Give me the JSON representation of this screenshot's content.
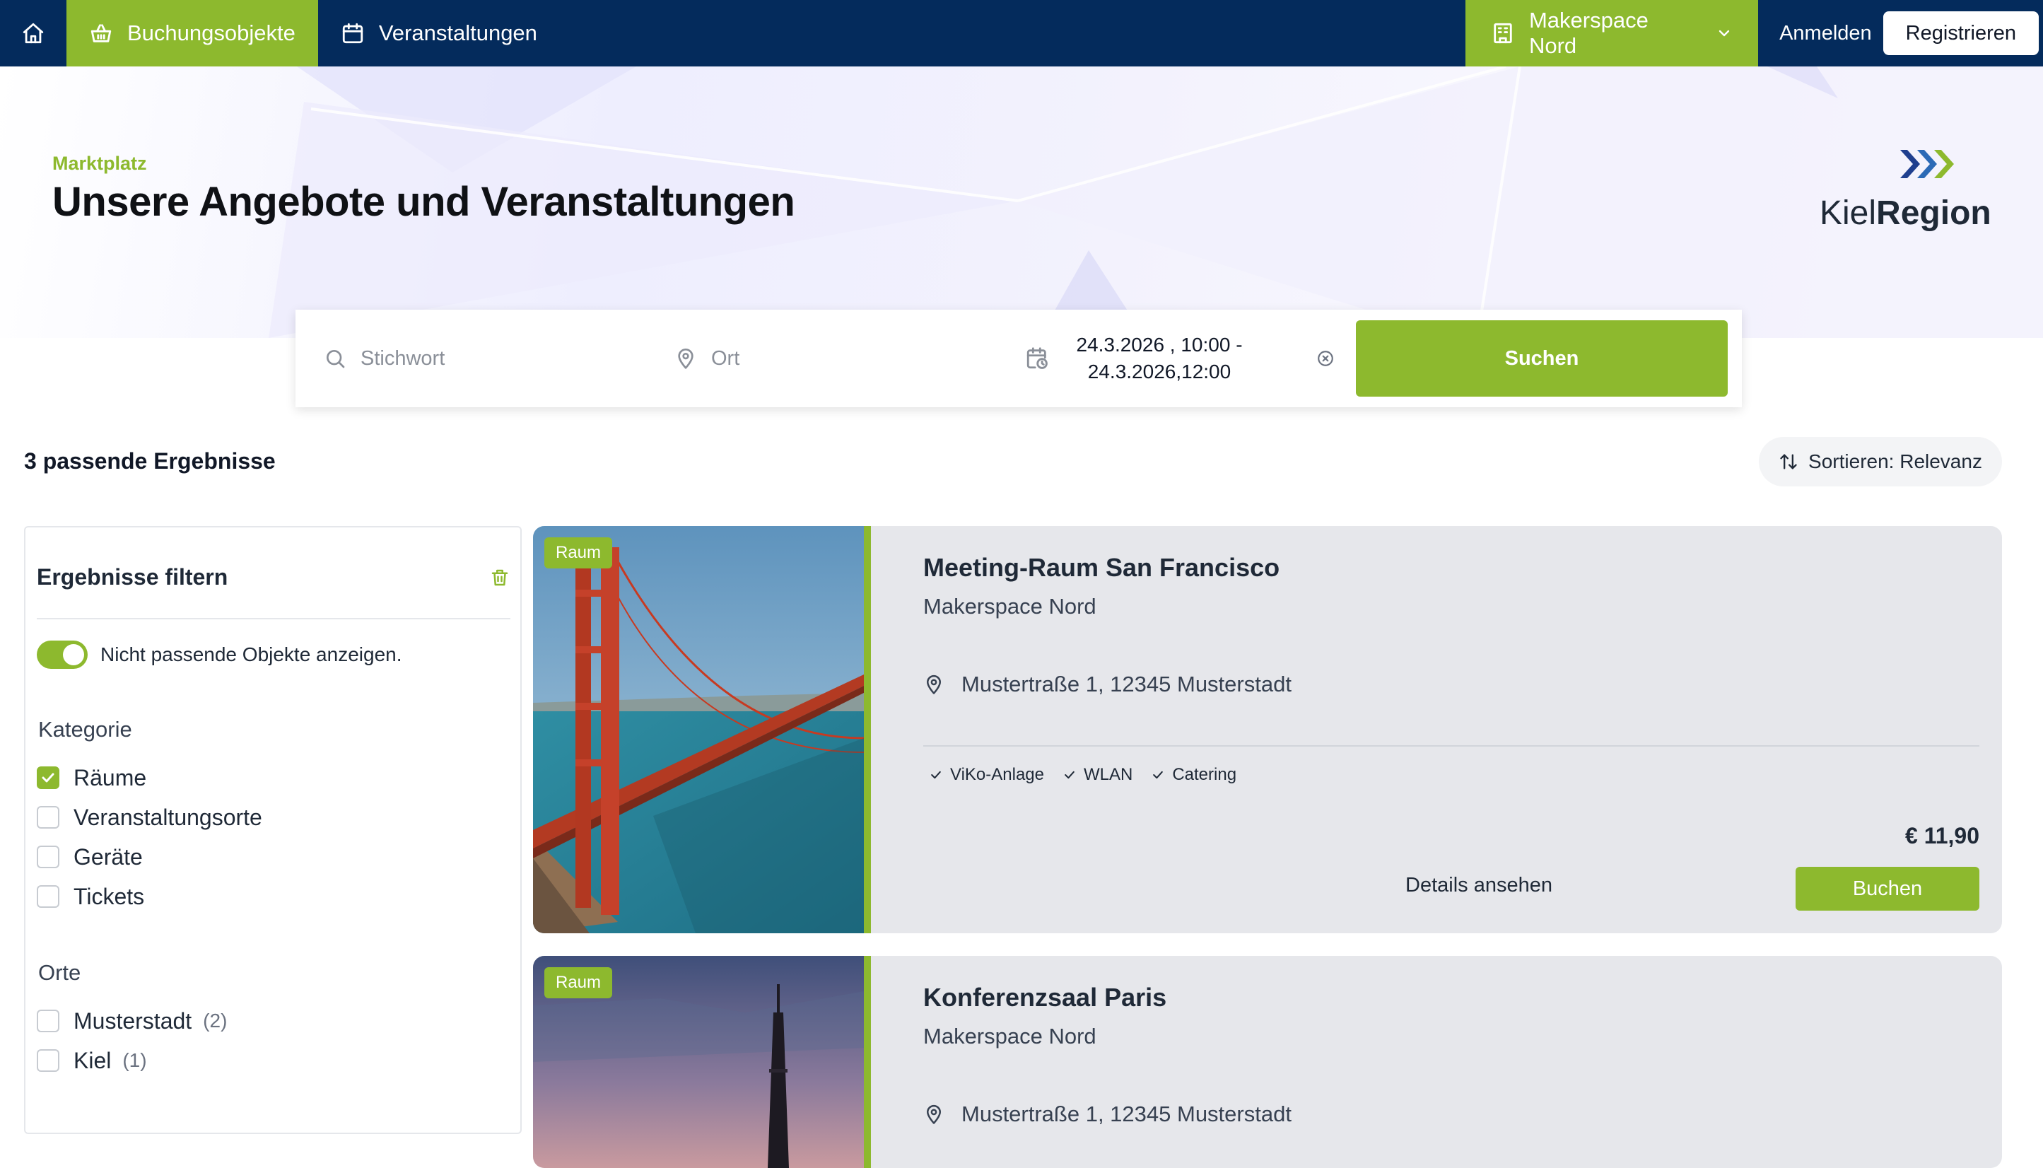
{
  "nav": {
    "tabs": [
      {
        "label": "Buchungsobjekte",
        "icon": "basket-icon",
        "active": true
      },
      {
        "label": "Veranstaltungen",
        "icon": "calendar-icon",
        "active": false
      }
    ],
    "location": {
      "label": "Makerspace Nord",
      "icon": "building-icon"
    },
    "login_label": "Anmelden",
    "register_label": "Registrieren"
  },
  "hero": {
    "kicker": "Marktplatz",
    "title": "Unsere Angebote und Veranstaltungen",
    "logo": {
      "text_light": "Kiel",
      "text_bold": "Region"
    }
  },
  "search": {
    "keyword_placeholder": "Stichwort",
    "place_placeholder": "Ort",
    "date_line1": "24.3.2026 , 10:00 -",
    "date_line2": "24.3.2026,12:00",
    "button_label": "Suchen"
  },
  "results": {
    "count_label": "3 passende Ergebnisse",
    "sort_label": "Sortieren: Relevanz"
  },
  "filters": {
    "title": "Ergebnisse filtern",
    "toggle_label": "Nicht passende Objekte anzeigen.",
    "toggle_on": true,
    "category_label": "Kategorie",
    "categories": [
      {
        "label": "Räume",
        "checked": true
      },
      {
        "label": "Veranstaltungsorte",
        "checked": false
      },
      {
        "label": "Geräte",
        "checked": false
      },
      {
        "label": "Tickets",
        "checked": false
      }
    ],
    "places_label": "Orte",
    "places": [
      {
        "label": "Musterstadt",
        "count": "(2)",
        "checked": false
      },
      {
        "label": "Kiel",
        "count": "(1)",
        "checked": false
      }
    ]
  },
  "cards": [
    {
      "badge": "Raum",
      "title": "Meeting-Raum San Francisco",
      "provider": "Makerspace Nord",
      "address": "Mustertraße 1, 12345 Musterstadt",
      "features": [
        "ViKo-Anlage",
        "WLAN",
        "Catering"
      ],
      "price": "€ 11,90",
      "details_label": "Details ansehen",
      "book_label": "Buchen"
    },
    {
      "badge": "Raum",
      "title": "Konferenzsaal Paris",
      "provider": "Makerspace Nord",
      "address": "Mustertraße 1, 12345 Musterstadt"
    }
  ],
  "colors": {
    "nav_bg": "#042b5c",
    "accent": "#8db92e",
    "card_bg": "#e6e7eb"
  }
}
